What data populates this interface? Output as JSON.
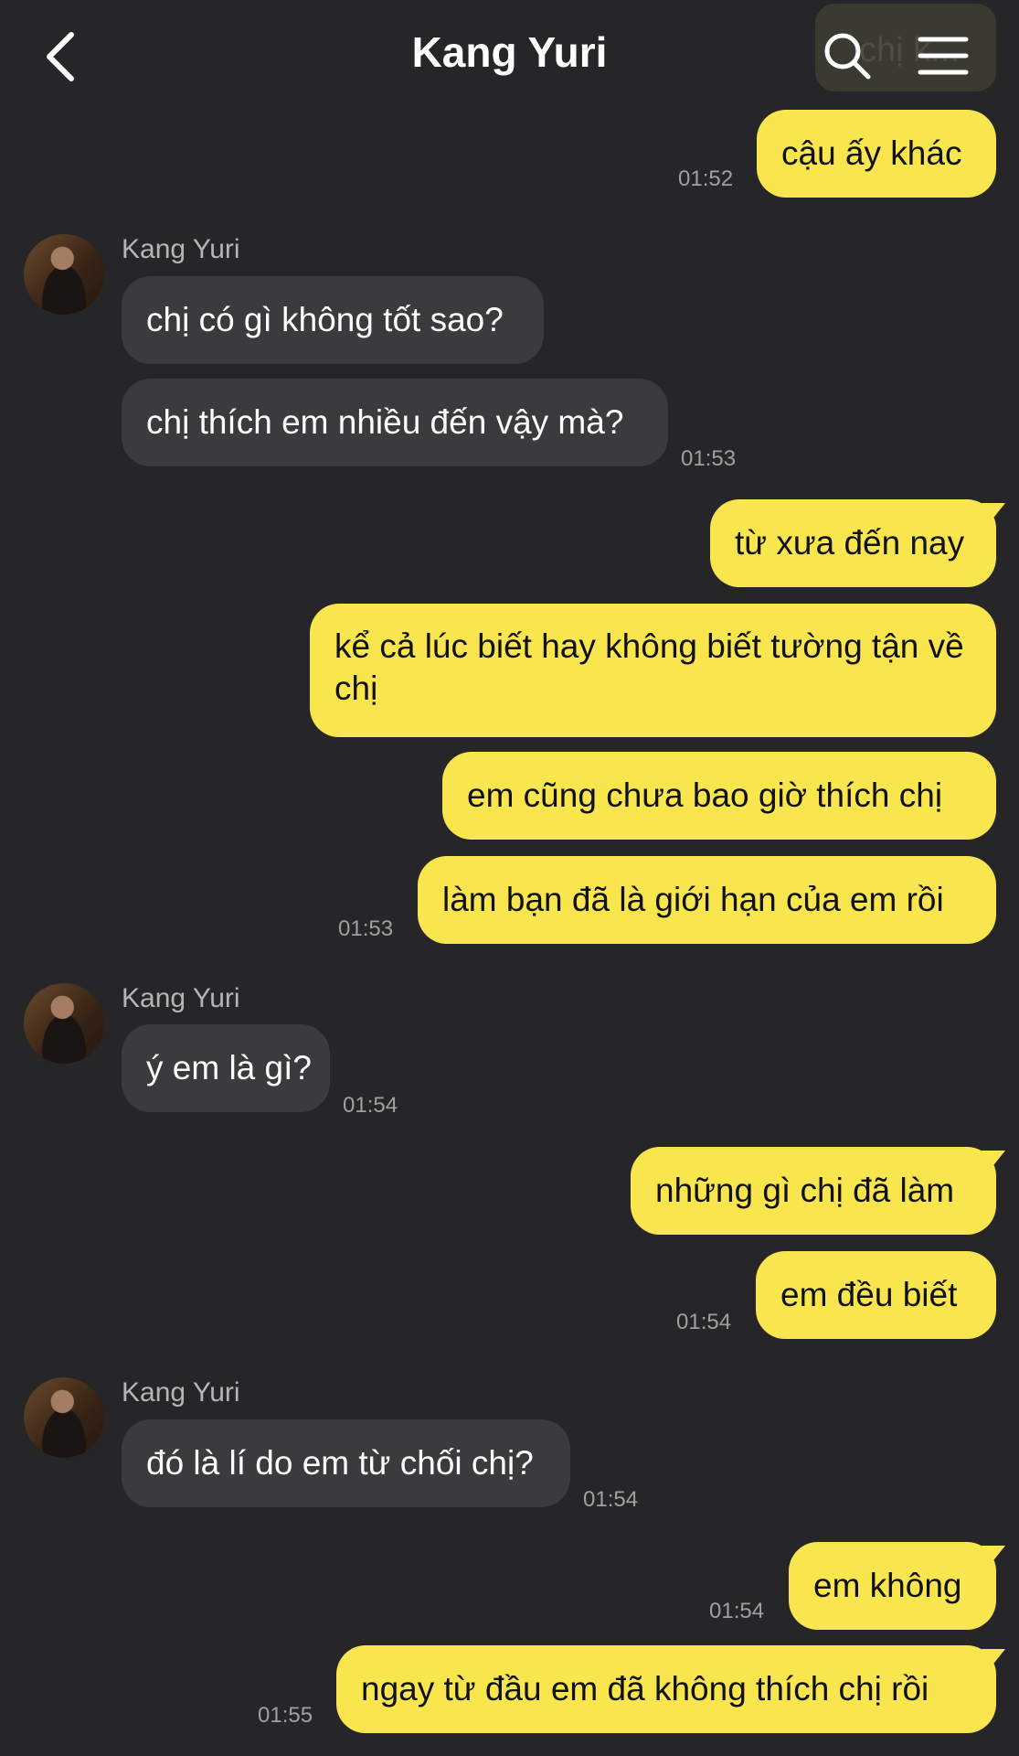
{
  "header": {
    "title": "Kang Yuri",
    "preview_text": "chị k..."
  },
  "sender_name": "Kang Yuri",
  "messages": {
    "m1": "cậu ấy khác",
    "m2": "chị có gì không tốt sao?",
    "m3": "chị thích em nhiều đến vậy mà?",
    "m4": "từ xưa đến nay",
    "m5": "kể cả lúc biết hay không biết tường tận về chị",
    "m6": "em cũng chưa bao giờ thích chị",
    "m7": "làm bạn đã là giới hạn của em rồi",
    "m8": "ý em là gì?",
    "m9": "những gì chị đã làm",
    "m10": "em đều biết",
    "m11": "đó là lí do em từ chối chị?",
    "m12": "em không",
    "m13": "ngay từ đầu em đã không thích chị rồi"
  },
  "times": {
    "t1": "01:52",
    "t2": "01:53",
    "t3": "01:53",
    "t4": "01:54",
    "t5": "01:54",
    "t6": "01:54",
    "t7": "01:54",
    "t8": "01:55"
  },
  "colors": {
    "background": "#262628",
    "my_bubble": "#f9e64f",
    "their_bubble": "#3b3b3d"
  }
}
